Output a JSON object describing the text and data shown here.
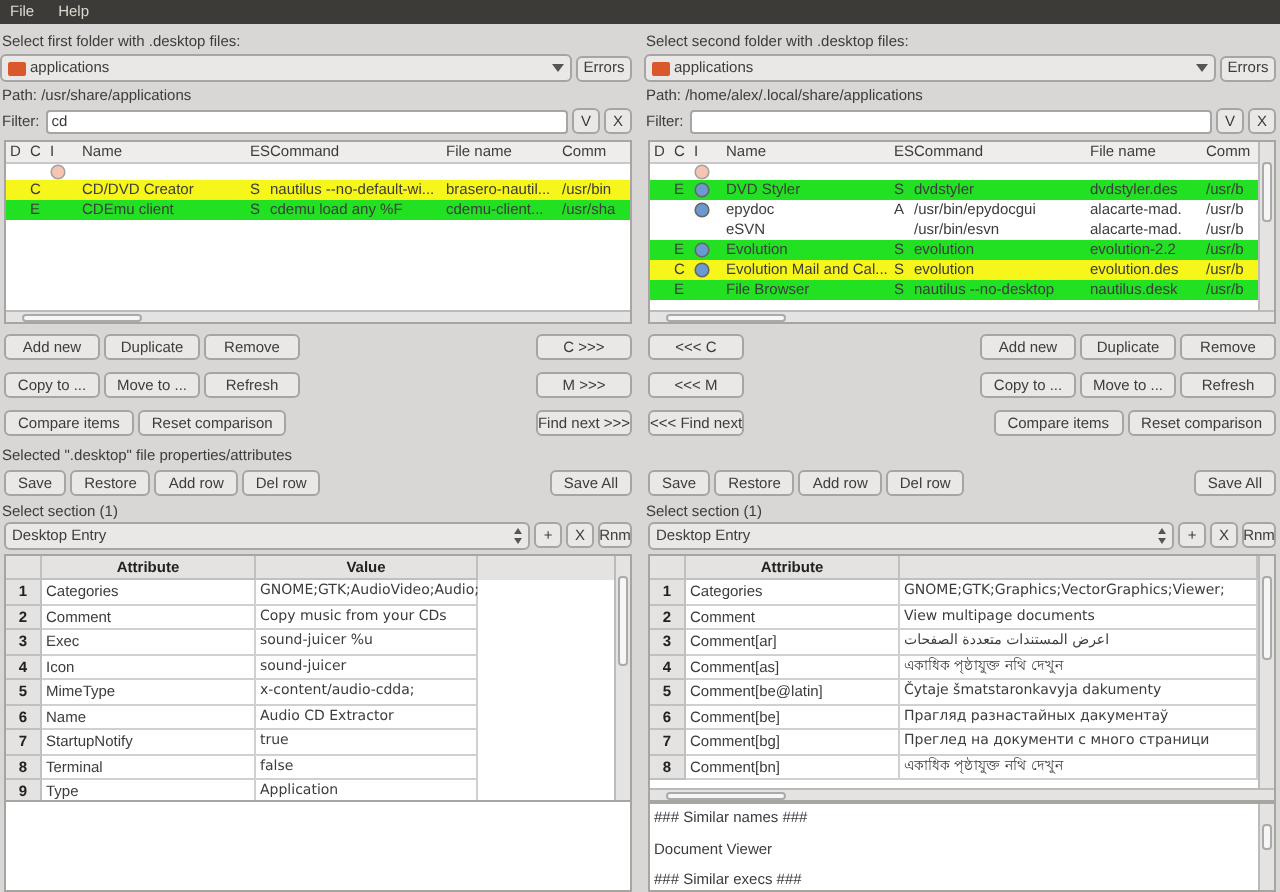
{
  "menu": [
    "File",
    "Help"
  ],
  "panels": [
    {
      "folder_prompt": "Select first folder with .desktop files:",
      "folder": "applications",
      "errors": "Errors",
      "path": "Path: /usr/share/applications",
      "filter_label": "Filter:",
      "filter": "cd",
      "filter_buttons": [
        "V",
        "X"
      ],
      "columns": [
        "D",
        "C",
        "I",
        "Name",
        "ES",
        "Command",
        "File name",
        "Comm"
      ],
      "rows": [
        {
          "kind": "cut",
          "icon": true,
          "color": "#ffffff"
        },
        {
          "kind": "entry",
          "icon": false,
          "color": "#f6f61a",
          "d": "",
          "c": "C",
          "name": "CD/DVD Creator",
          "es": "S",
          "command": "nautilus --no-default-wi...",
          "file_name": "brasero-nautil...",
          "comm": "/usr/bin"
        },
        {
          "kind": "entry",
          "icon": false,
          "color": "#22e022",
          "d": "",
          "c": "E",
          "name": "CDEmu client",
          "es": "S",
          "command": "cdemu load any %F",
          "file_name": "cdemu-client...",
          "comm": "/usr/sha"
        }
      ],
      "transfer_buttons": [
        "C >>>",
        "M >>>",
        "Find next >>>"
      ],
      "action_rows": [
        [
          "Add new",
          "Duplicate",
          "Remove"
        ],
        [
          "Copy to ...",
          "Move to ...",
          "Refresh"
        ],
        [
          "Compare items",
          "Reset comparison"
        ]
      ],
      "selected_caption": "Selected \".desktop\" file properties/attributes",
      "edit_buttons": [
        "Save",
        "Restore",
        "Add row",
        "Del row"
      ],
      "save_all": "Save All",
      "section_prompt": "Select section (1)",
      "section": "Desktop Entry",
      "section_buttons": [
        "+",
        "X",
        "Rnm"
      ],
      "attr_columns": [
        "Attribute",
        "Value"
      ],
      "attributes": [
        {
          "n": "1",
          "attribute": "Categories",
          "value": "GNOME;GTK;AudioVideo;Audio;"
        },
        {
          "n": "2",
          "attribute": "Comment",
          "value": "Copy music from your CDs"
        },
        {
          "n": "3",
          "attribute": "Exec",
          "value": "sound-juicer %u"
        },
        {
          "n": "4",
          "attribute": "Icon",
          "value": "sound-juicer"
        },
        {
          "n": "5",
          "attribute": "MimeType",
          "value": "x-content/audio-cdda;"
        },
        {
          "n": "6",
          "attribute": "Name",
          "value": "Audio CD Extractor"
        },
        {
          "n": "7",
          "attribute": "StartupNotify",
          "value": "true"
        },
        {
          "n": "8",
          "attribute": "Terminal",
          "value": "false"
        },
        {
          "n": "9",
          "attribute": "Type",
          "value": "Application"
        }
      ]
    },
    {
      "folder_prompt": "Select second folder with .desktop files:",
      "folder": "applications",
      "errors": "Errors",
      "path": "Path: /home/alex/.local/share/applications",
      "filter_label": "Filter:",
      "filter_buttons": [
        "V",
        "X"
      ],
      "columns": [
        "D",
        "C",
        "I",
        "Name",
        "ES",
        "Command",
        "File name",
        "Comm"
      ],
      "rows": [
        {
          "kind": "cut",
          "icon": true,
          "color": "#ffffff"
        },
        {
          "kind": "entry",
          "icon": true,
          "color": "#22e022",
          "d": "",
          "c": "E",
          "name": "DVD Styler",
          "es": "S",
          "command": "dvdstyler",
          "file_name": "dvdstyler.des",
          "comm": "/usr/b"
        },
        {
          "kind": "entry",
          "icon": true,
          "color": "#ffffff",
          "d": "",
          "c": "",
          "name": "epydoc",
          "es": "A",
          "command": "/usr/bin/epydocgui",
          "file_name": "alacarte-mad.",
          "comm": "/usr/b"
        },
        {
          "kind": "entry",
          "icon": false,
          "color": "#ffffff",
          "d": "",
          "c": "",
          "name": "eSVN",
          "es": "",
          "command": "/usr/bin/esvn",
          "file_name": "alacarte-mad.",
          "comm": "/usr/b"
        },
        {
          "kind": "entry",
          "icon": true,
          "color": "#22e022",
          "d": "",
          "c": "E",
          "name": "Evolution",
          "es": "S",
          "command": "evolution",
          "file_name": "evolution-2.2",
          "comm": "/usr/b"
        },
        {
          "kind": "entry",
          "icon": true,
          "color": "#f6f61a",
          "d": "",
          "c": "C",
          "name": "Evolution Mail and Cal...",
          "es": "S",
          "command": "evolution",
          "file_name": "evolution.des",
          "comm": "/usr/b"
        },
        {
          "kind": "entry",
          "icon": false,
          "color": "#22e022",
          "d": "",
          "c": "E",
          "name": "File Browser",
          "es": "S",
          "command": "nautilus --no-desktop",
          "file_name": "nautilus.desk",
          "comm": "/usr/b"
        }
      ],
      "transfer_buttons": [
        "<<< C",
        "<<< M",
        "<<< Find next"
      ],
      "action_rows": [
        [
          "Add new",
          "Duplicate",
          "Remove"
        ],
        [
          "Copy to ...",
          "Move to ...",
          "Refresh"
        ],
        [
          "Compare items",
          "Reset comparison"
        ]
      ],
      "edit_buttons": [
        "Save",
        "Restore",
        "Add row",
        "Del row"
      ],
      "save_all": "Save All",
      "section_prompt": "Select section (1)",
      "section": "Desktop Entry",
      "section_buttons": [
        "+",
        "X",
        "Rnm"
      ],
      "attr_columns": [
        "Attribute"
      ],
      "attributes": [
        {
          "n": "1",
          "attribute": "Categories",
          "value": "GNOME;GTK;Graphics;VectorGraphics;Viewer;"
        },
        {
          "n": "2",
          "attribute": "Comment",
          "value": "View multipage documents"
        },
        {
          "n": "3",
          "attribute": "Comment[ar]",
          "value": "اعرض المستندات متعددة الصفحات"
        },
        {
          "n": "4",
          "attribute": "Comment[as]",
          "value": "একাধিক পৃষ্ঠাযুক্ত নথি দেখুন"
        },
        {
          "n": "5",
          "attribute": "Comment[be@latin]",
          "value": "Čytaje šmatstaronkavyja dakumenty"
        },
        {
          "n": "6",
          "attribute": "Comment[be]",
          "value": "Прагляд разнастайных дакументаў"
        },
        {
          "n": "7",
          "attribute": "Comment[bg]",
          "value": "Преглед на документи с много страници"
        },
        {
          "n": "8",
          "attribute": "Comment[bn]",
          "value": "একাধিক পৃষ্ঠাযুক্ত নথি দেখুন"
        }
      ],
      "notes": [
        "### Similar names ###",
        "Document Viewer",
        "### Similar execs ###"
      ]
    }
  ]
}
